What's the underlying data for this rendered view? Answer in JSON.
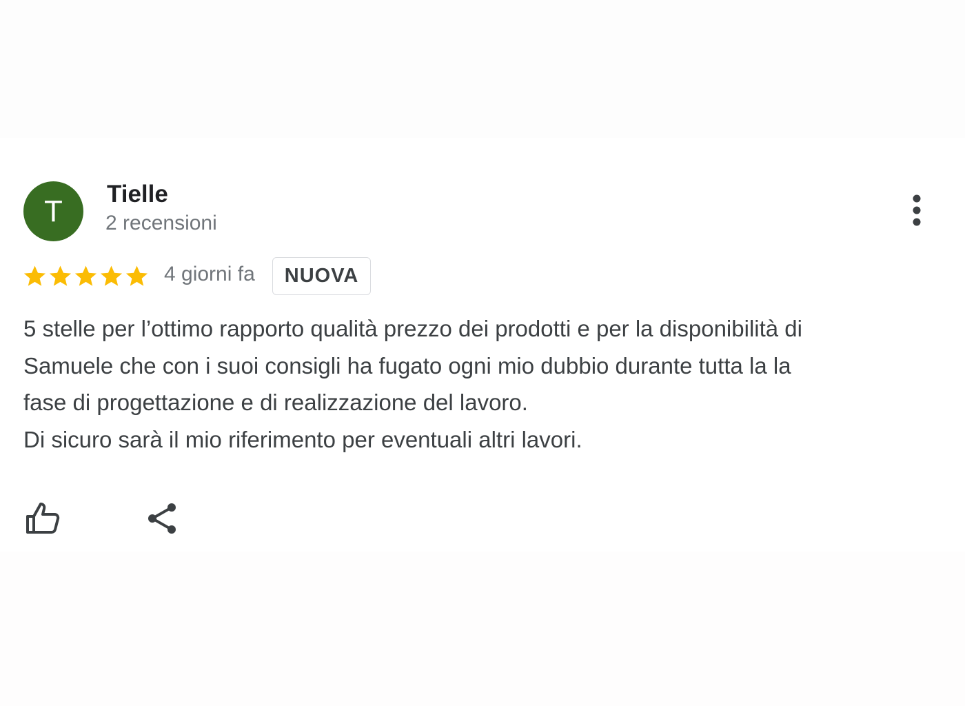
{
  "review": {
    "avatar_initial": "T",
    "author_name": "Tielle",
    "review_count": "2 recensioni",
    "rating": 5,
    "rating_max": 5,
    "time": "4 giorni fa",
    "badge": "NUOVA",
    "text_lines": [
      "5 stelle per l’ottimo rapporto qualità prezzo dei prodotti e per la disponibilità di",
      "Samuele che con i suoi consigli ha fugato ogni mio dubbio durante tutta la la",
      "fase di progettazione e di realizzazione del lavoro.",
      "Di sicuro sarà il mio riferimento per eventuali altri lavori."
    ]
  },
  "icons": {
    "more": "more-vert-icon",
    "star": "star-icon",
    "like": "thumb-up-icon",
    "share": "share-icon"
  },
  "colors": {
    "avatar_bg": "#386d22",
    "star": "#fbbc04",
    "text": "#3c4043",
    "secondary_text": "#70757a",
    "badge_border": "#dadce0"
  }
}
